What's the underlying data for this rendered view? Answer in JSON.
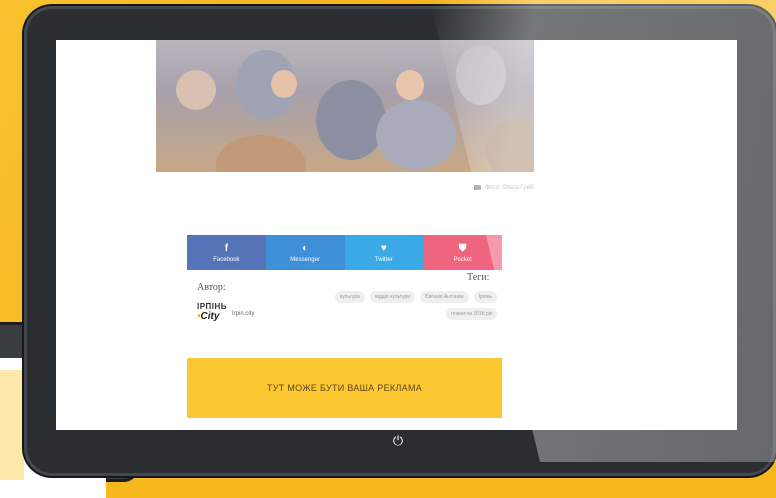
{
  "photo": {
    "caption": "Фото: Ольга Гриб"
  },
  "share": [
    {
      "label": "Facebook",
      "icon": "f",
      "color": "#5574b7"
    },
    {
      "label": "Messenger",
      "icon": "◐",
      "color": "#3d8fd8"
    },
    {
      "label": "Twitter",
      "icon": "♥",
      "color": "#3ba9e6"
    },
    {
      "label": "Pocket",
      "icon": "⛊",
      "color": "#ef6580"
    }
  ],
  "author": {
    "label": "Автор:",
    "logo_line1": "IРПIНЬ",
    "logo_line2": "City",
    "name": "Irpin.city"
  },
  "tags": {
    "label": "Теги:",
    "items": [
      "культура",
      "відділ культури",
      "Євгенія Антонюк",
      "Ірпінь",
      "плани на 2018 рік"
    ]
  },
  "ad": {
    "text": "ТУТ МОЖЕ БУТИ ВАША РЕКЛАМА"
  },
  "device": {
    "power_icon": "⏻"
  }
}
